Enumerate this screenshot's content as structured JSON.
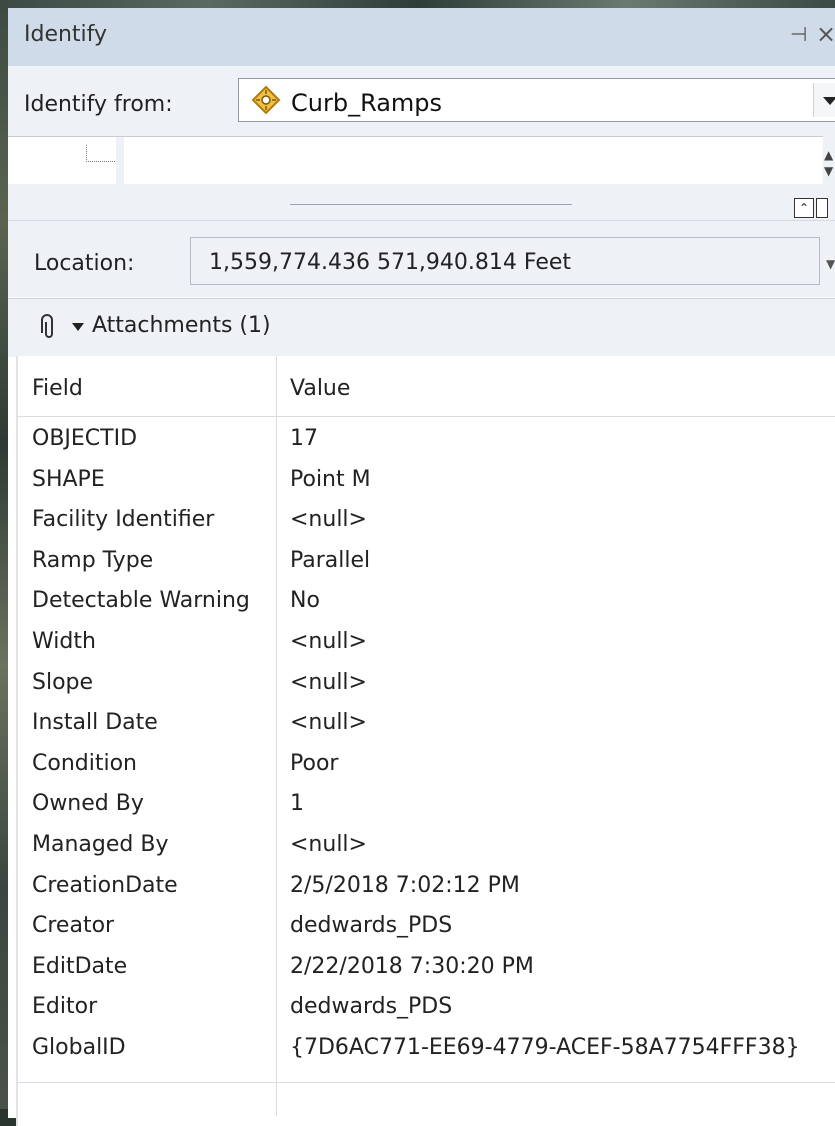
{
  "window": {
    "title": "Identify",
    "pin_icon": "pin-icon",
    "close_icon": "close-icon"
  },
  "identify_from": {
    "label": "Identify from:",
    "selected": "Curb_Ramps",
    "layer_icon": "point-layer-icon"
  },
  "location": {
    "label": "Location:",
    "value": "1,559,774.436  571,940.814 Feet"
  },
  "attachments": {
    "label": "Attachments (1)"
  },
  "table": {
    "headers": {
      "field": "Field",
      "value": "Value"
    },
    "rows": [
      {
        "field": "OBJECTID",
        "value": "17"
      },
      {
        "field": "SHAPE",
        "value": "Point M"
      },
      {
        "field": "Facility Identifier",
        "value": "<null>"
      },
      {
        "field": "Ramp Type",
        "value": "Parallel"
      },
      {
        "field": "Detectable Warning",
        "value": "No"
      },
      {
        "field": "Width",
        "value": "<null>"
      },
      {
        "field": "Slope",
        "value": "<null>"
      },
      {
        "field": "Install Date",
        "value": "<null>"
      },
      {
        "field": "Condition",
        "value": "Poor"
      },
      {
        "field": "Owned By",
        "value": "1"
      },
      {
        "field": "Managed By",
        "value": "<null>"
      },
      {
        "field": "CreationDate",
        "value": "2/5/2018 7:02:12 PM"
      },
      {
        "field": "Creator",
        "value": "dedwards_PDS"
      },
      {
        "field": "EditDate",
        "value": "2/22/2018 7:30:20 PM"
      },
      {
        "field": "Editor",
        "value": "dedwards_PDS"
      },
      {
        "field": "GlobalID",
        "value": "{7D6AC771-EE69-4779-ACEF-58A7754FFF38}"
      }
    ]
  }
}
